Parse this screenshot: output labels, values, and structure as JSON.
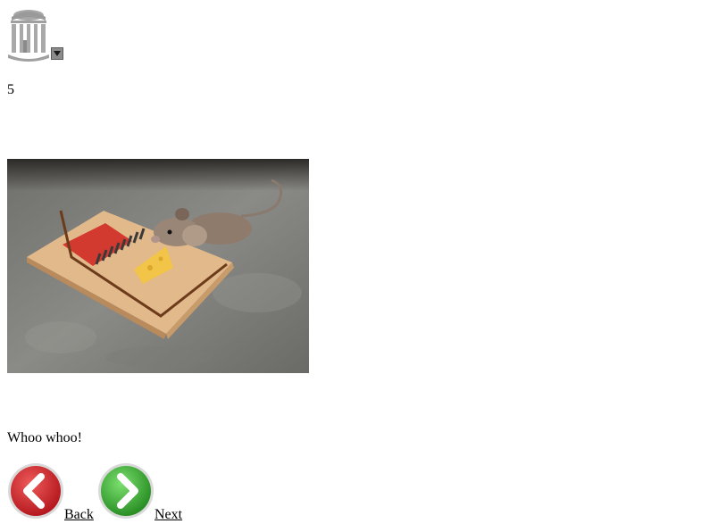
{
  "logo": {
    "icon": "old-well-icon",
    "dropdown_icon": "triangle-down-icon"
  },
  "page_number": "5",
  "photo": {
    "alt": "mouse in a trap"
  },
  "caption": "Whoo whoo!",
  "navigation": {
    "back_label": "Back",
    "next_label": "Next",
    "back_color": "#c0161a",
    "next_color": "#3aa832"
  }
}
